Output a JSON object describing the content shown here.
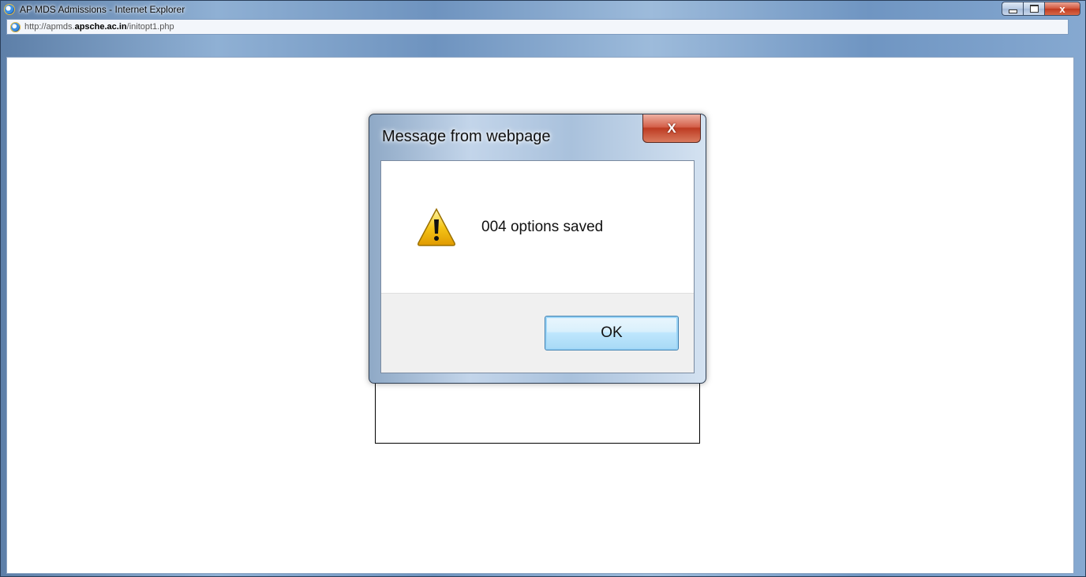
{
  "window": {
    "title": "AP MDS Admissions - Internet Explorer",
    "address": {
      "prefix": "http://apmds.",
      "domain": "apsche.ac.in",
      "path": "/initopt1.php"
    },
    "caption_buttons": {
      "close_glyph": "x"
    }
  },
  "dialog": {
    "title": "Message from webpage",
    "close_glyph": "X",
    "message": "004 options saved",
    "ok_label": "OK",
    "icon": "warning-icon"
  },
  "colors": {
    "close_red": "#c03a1f",
    "ok_blue": "#bee6fd",
    "warning_yellow": "#f5c518"
  }
}
